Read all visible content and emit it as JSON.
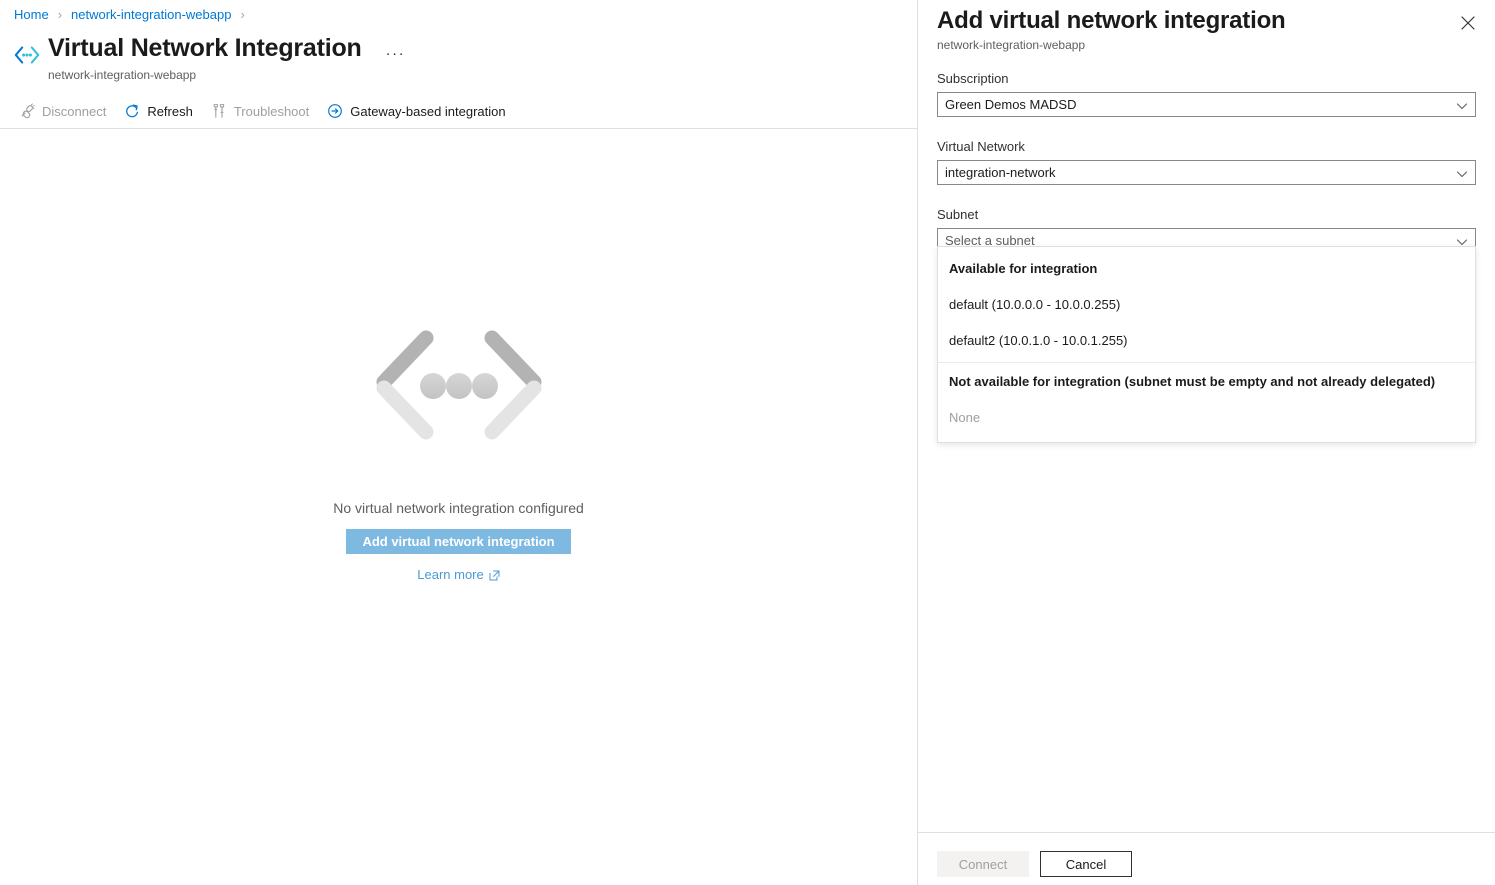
{
  "breadcrumb": {
    "items": [
      {
        "label": "Home",
        "icon": ""
      },
      {
        "label": "network-integration-webapp",
        "icon": ""
      }
    ],
    "separator": "›"
  },
  "header": {
    "icon": "vnet-integration-icon",
    "title": "Virtual Network Integration",
    "subtitle": "network-integration-webapp",
    "more_label": "···"
  },
  "command_bar": {
    "items": [
      {
        "label": "Disconnect",
        "icon": "disconnect-icon",
        "disabled": true
      },
      {
        "label": "Refresh",
        "icon": "refresh-icon",
        "disabled": false
      },
      {
        "label": "Troubleshoot",
        "icon": "troubleshoot-icon",
        "disabled": true
      },
      {
        "label": "Gateway-based integration",
        "icon": "arrow-right-circle-icon",
        "disabled": false
      }
    ]
  },
  "empty_state": {
    "icon": "code-brackets-ellipsis-icon",
    "message": "No virtual network integration configured",
    "primary_button": "Add virtual network integration",
    "link": "Learn more",
    "link_icon": "external-link-icon"
  },
  "panel": {
    "title": "Add virtual network integration",
    "subtitle": "network-integration-webapp",
    "close_icon": "close-icon",
    "fields": [
      {
        "label": "Subscription",
        "value": "Green Demos MADSD",
        "placeholder": "",
        "caret_icon": "chevron-down-icon"
      },
      {
        "label": "Virtual Network",
        "value": "integration-network",
        "placeholder": "",
        "caret_icon": "chevron-down-icon"
      },
      {
        "label": "Subnet",
        "value": "",
        "placeholder": "Select a subnet",
        "caret_icon": "chevron-down-icon"
      }
    ],
    "subnet_dropdown": {
      "groups": [
        {
          "header": "Available for integration",
          "options": [
            {
              "label": "default (10.0.0.0 - 10.0.0.255)",
              "muted": false
            },
            {
              "label": "default2 (10.0.1.0 - 10.0.1.255)",
              "muted": false
            }
          ]
        },
        {
          "header": "Not available for integration (subnet must be empty and not already delegated)",
          "options": [
            {
              "label": "None",
              "muted": true
            }
          ]
        }
      ]
    },
    "footer": {
      "connect_label": "Connect",
      "cancel_label": "Cancel"
    }
  },
  "colors": {
    "link": "#0078d4",
    "accent_button": "#7eb9e2",
    "icon_blue": "#0078d4",
    "icon_teal": "#32bedd",
    "disabled_text": "#a19f9d",
    "border": "#e1dfdd"
  }
}
